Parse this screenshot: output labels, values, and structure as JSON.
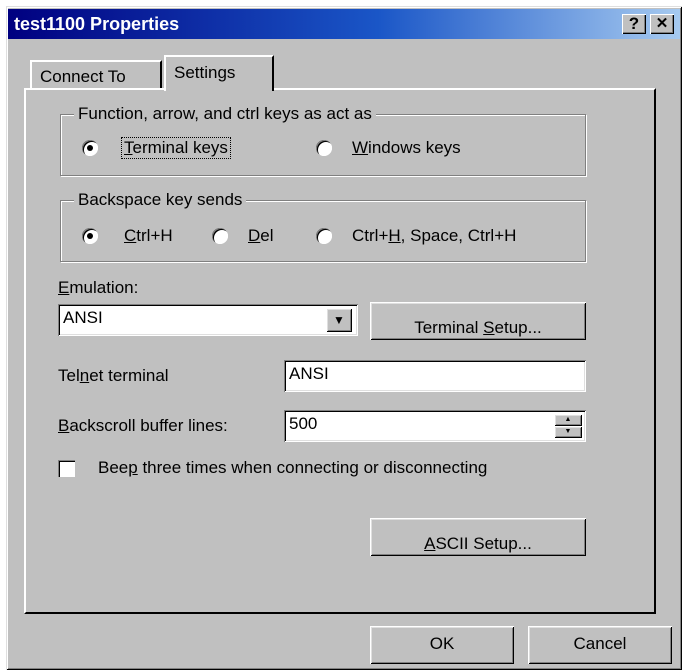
{
  "window": {
    "title": "test1100 Properties",
    "help_glyph": "?",
    "close_glyph": "✕"
  },
  "tabs": [
    {
      "label": "Connect To",
      "active": false
    },
    {
      "label": "Settings",
      "active": true
    }
  ],
  "keys_group": {
    "legend": "Function, arrow, and ctrl keys as act as",
    "options": [
      {
        "pre": "",
        "mnemonic": "T",
        "post": "erminal keys",
        "selected": true
      },
      {
        "pre": "",
        "mnemonic": "W",
        "post": "indows keys",
        "selected": false
      }
    ]
  },
  "backspace_group": {
    "legend": "Backspace key sends",
    "options": [
      {
        "pre": "",
        "mnemonic": "C",
        "post": "trl+H",
        "selected": true
      },
      {
        "pre": "",
        "mnemonic": "D",
        "post": "el",
        "selected": false
      },
      {
        "pre": "Ctrl+",
        "mnemonic": "H",
        "post": ", Space, Ctrl+H",
        "selected": false
      }
    ]
  },
  "emulation": {
    "label_mnemonic": "E",
    "label_rest": "mulation:",
    "value": "ANSI",
    "dropdown_glyph": "▼"
  },
  "terminal_setup_button": {
    "pre": "Terminal ",
    "mnemonic": "S",
    "post": "etup..."
  },
  "telnet": {
    "pre": "Tel",
    "mnemonic": "n",
    "post": "et terminal",
    "value": "ANSI"
  },
  "backscroll": {
    "label_mnemonic": "B",
    "label_rest": "ackscroll buffer lines:",
    "value": "500",
    "up_glyph": "▲",
    "down_glyph": "▼"
  },
  "beep": {
    "pre": "Bee",
    "mnemonic": "p",
    "post": " three times when connecting or disconnecting",
    "checked": false
  },
  "ascii_setup_button": {
    "pre": "",
    "mnemonic": "A",
    "post": "SCII Setup..."
  },
  "ok_button": {
    "label": "OK"
  },
  "cancel_button": {
    "label": "Cancel"
  }
}
